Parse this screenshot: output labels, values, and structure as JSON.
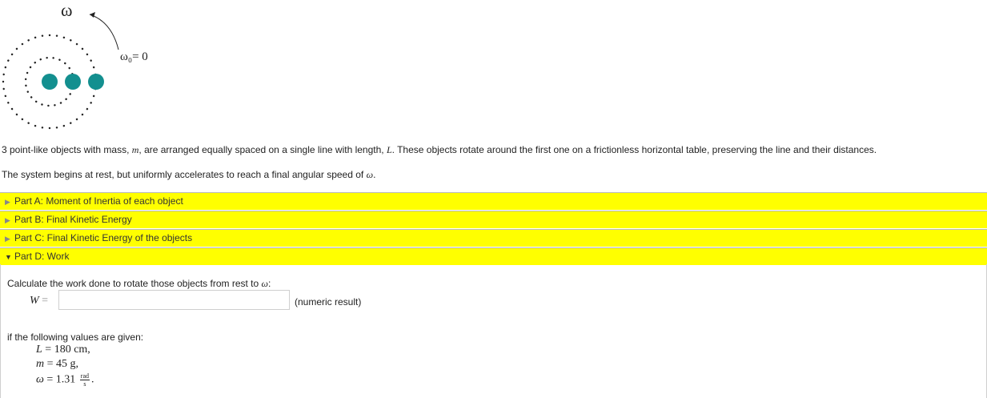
{
  "figure": {
    "omega_label": "ω",
    "omega0_label": "ω₀= 0",
    "dot_color": "#138f8f"
  },
  "description": {
    "line1_a": "3 point-like objects with mass, ",
    "mass_symbol": "m",
    "line1_b": ", are arranged equally spaced on a single line with length, ",
    "length_symbol": "L",
    "line1_c": ". These objects rotate around the first one on a frictionless horizontal table, preserving the line and their distances.",
    "line2_a": "The system begins at rest, but uniformly accelerates to reach a final angular speed of ",
    "omega_symbol": "ω",
    "line2_b": "."
  },
  "parts": [
    {
      "label": "Part A: Moment of Inertia of each object",
      "state": "collapsed"
    },
    {
      "label": "Part B: Final Kinetic Energy",
      "state": "collapsed"
    },
    {
      "label": "Part C: Final Kinetic Energy of the objects",
      "state": "collapsed"
    },
    {
      "label": "Part D: Work",
      "state": "expanded"
    }
  ],
  "colors": {
    "part_bar": "#ffff00"
  },
  "part_d": {
    "question": "Calculate the work done to rotate those objects from rest to ",
    "question_symbol": "ω",
    "question_end": ":",
    "answer_symbol": "W",
    "answer_equals": "=",
    "answer_value": "",
    "unit_hint": "(numeric result)",
    "given_intro": "if the following values are given:",
    "given": [
      {
        "symbol": "L",
        "rest": " = 180 cm,"
      },
      {
        "symbol": "m",
        "rest": " = 45 g,"
      },
      {
        "symbol": "ω",
        "value": " = 1.31 ",
        "unit_num": "rad",
        "unit_den": "s",
        "end": "."
      }
    ]
  }
}
